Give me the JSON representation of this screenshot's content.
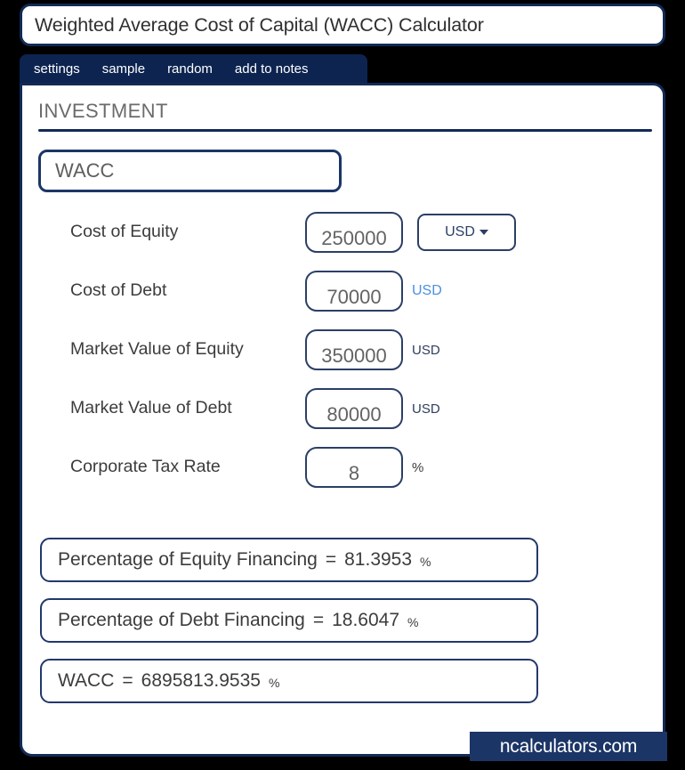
{
  "window": {
    "title": "Weighted Average Cost of Capital (WACC) Calculator"
  },
  "tabs": [
    {
      "label": "settings"
    },
    {
      "label": "sample"
    },
    {
      "label": "random"
    },
    {
      "label": "add to notes"
    }
  ],
  "section": {
    "title": "INVESTMENT"
  },
  "name_field": {
    "value": "WACC"
  },
  "inputs": [
    {
      "label": "Cost of Equity",
      "value": "250000",
      "unit_type": "select",
      "unit": "USD"
    },
    {
      "label": "Cost of Debt",
      "value": "70000",
      "unit_type": "link",
      "unit": "USD"
    },
    {
      "label": "Market Value of Equity",
      "value": "350000",
      "unit_type": "text",
      "unit": "USD"
    },
    {
      "label": "Market Value of Debt",
      "value": "80000",
      "unit_type": "text",
      "unit": "USD"
    },
    {
      "label": "Corporate Tax Rate",
      "value": "8",
      "unit_type": "percent",
      "unit": "%"
    }
  ],
  "results": [
    {
      "label": "Percentage of Equity Financing",
      "equals": "=",
      "value": "81.3953",
      "unit": "%"
    },
    {
      "label": "Percentage of Debt Financing",
      "equals": "=",
      "value": "18.6047",
      "unit": "%"
    },
    {
      "label": "WACC",
      "equals": "=",
      "value": "6895813.9535",
      "unit": "%"
    }
  ],
  "watermark": {
    "text": "ncalculators.com"
  },
  "colors": {
    "navy": "#0d2450",
    "border_navy": "#122a55",
    "accent_blue": "#4a90e2",
    "text_gray": "#3c3c3c",
    "value_gray": "#636363",
    "background": "#000000"
  }
}
